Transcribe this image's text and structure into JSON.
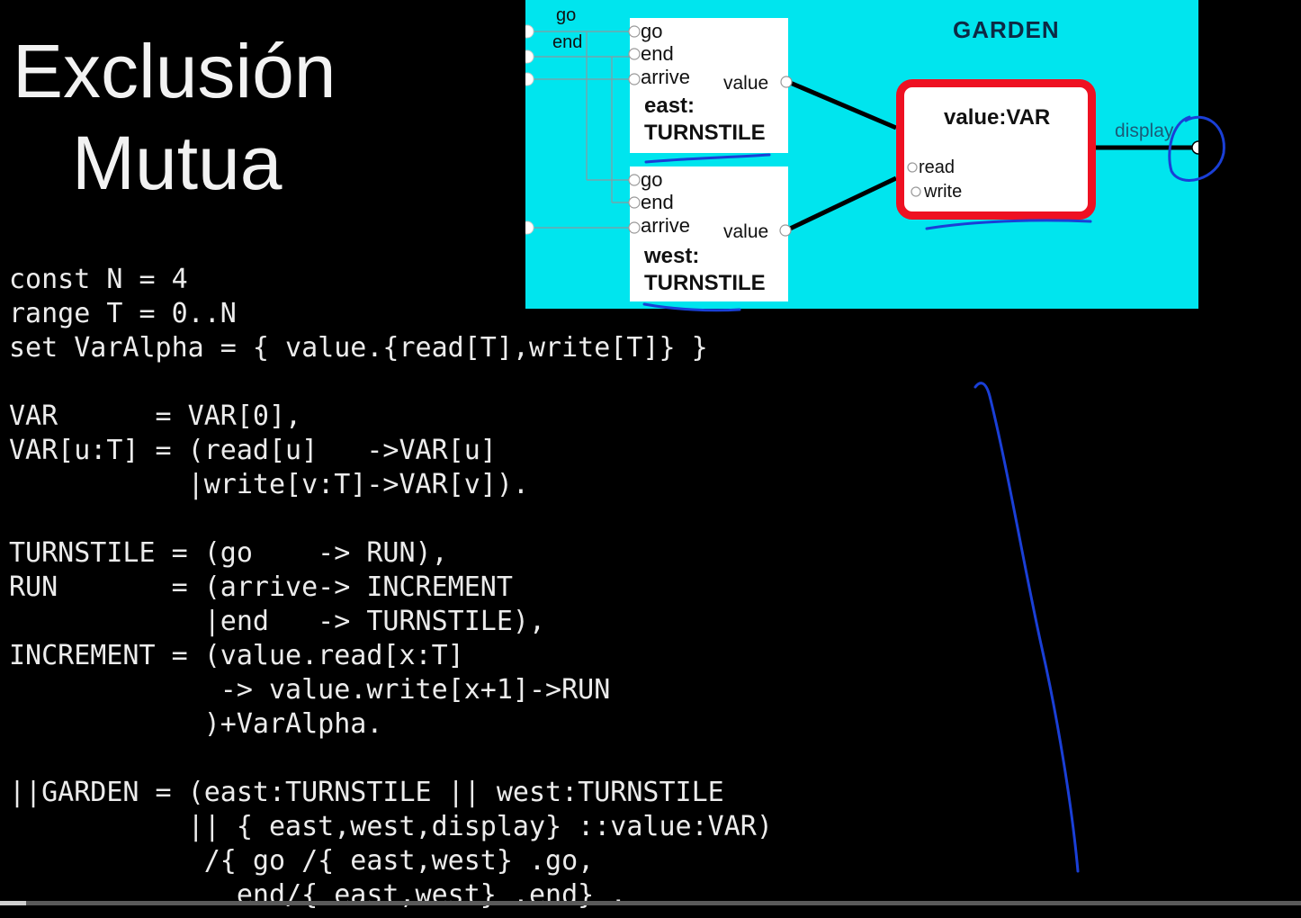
{
  "slide": {
    "title_line1": "Exclusión",
    "title_line2": "Mutua"
  },
  "diagram": {
    "garden_label": "GARDEN",
    "outer_ports": [
      "go",
      "end"
    ],
    "east": {
      "ports": [
        "go",
        "end",
        "arrive"
      ],
      "value_port": "value",
      "name": "east:",
      "type": "TURNSTILE"
    },
    "west": {
      "ports": [
        "go",
        "end",
        "arrive"
      ],
      "value_port": "value",
      "name": "west:",
      "type": "TURNSTILE"
    },
    "var": {
      "title": "value:VAR",
      "ports": [
        "read",
        "write"
      ]
    },
    "display_port": "display",
    "colors": {
      "background": "#00e5ee",
      "var_border": "#ee1122",
      "annotation_ink": "#1a3fd6"
    }
  },
  "code_lines": [
    "const N = 4",
    "range T = 0..N",
    "set VarAlpha = { value.{read[T],write[T]} }",
    "",
    "VAR      = VAR[0],",
    "VAR[u:T] = (read[u]   ->VAR[u]",
    "           |write[v:T]->VAR[v]).",
    "",
    "TURNSTILE = (go    -> RUN),",
    "RUN       = (arrive-> INCREMENT",
    "            |end   -> TURNSTILE),",
    "INCREMENT = (value.read[x:T]",
    "             -> value.write[x+1]->RUN",
    "            )+VarAlpha.",
    "",
    "||GARDEN = (east:TURNSTILE || west:TURNSTILE",
    "           || { east,west,display} ::value:VAR)",
    "            /{ go /{ east,west} .go,",
    "              end/{ east,west} .end} ."
  ],
  "video": {
    "progress_fraction": 0.02
  }
}
